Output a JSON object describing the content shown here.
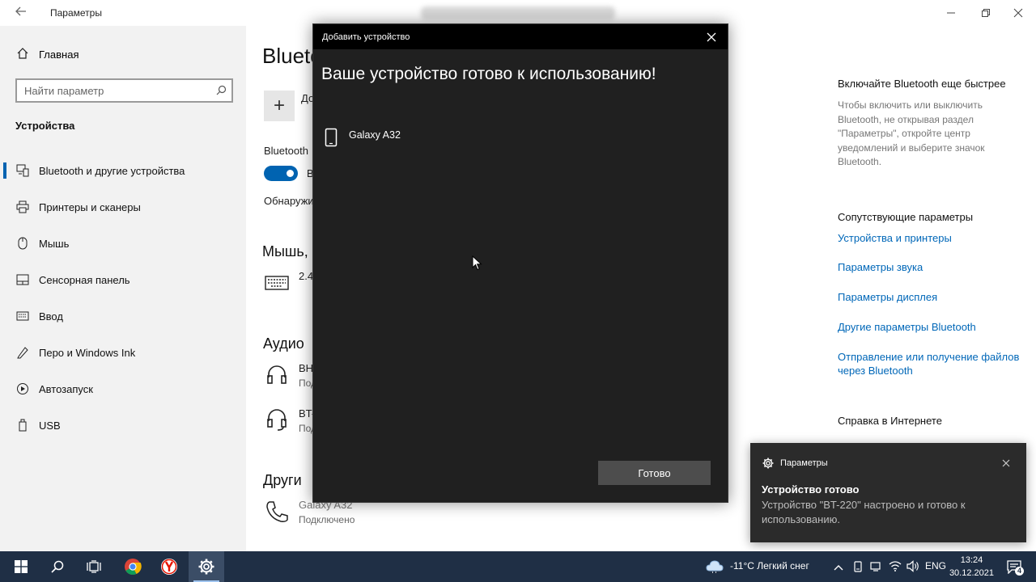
{
  "window": {
    "title": "Параметры"
  },
  "sidebar": {
    "home_label": "Главная",
    "search_placeholder": "Найти параметр",
    "section_label": "Устройства",
    "items": [
      {
        "label": "Bluetooth и другие устройства",
        "icon": "bluetooth-devices-icon",
        "active": true
      },
      {
        "label": "Принтеры и сканеры",
        "icon": "printer-icon"
      },
      {
        "label": "Мышь",
        "icon": "mouse-icon"
      },
      {
        "label": "Сенсорная панель",
        "icon": "touchpad-icon"
      },
      {
        "label": "Ввод",
        "icon": "keyboard-icon"
      },
      {
        "label": "Перо и Windows Ink",
        "icon": "pen-icon"
      },
      {
        "label": "Автозапуск",
        "icon": "autoplay-icon"
      },
      {
        "label": "USB",
        "icon": "usb-icon"
      }
    ]
  },
  "main": {
    "page_title": "Blueto",
    "add_label": "До",
    "bluetooth_label": "Bluetooth",
    "toggle_state": "on",
    "toggle_text": "В",
    "discover_text": "Обнаружи",
    "section_mouse": "Мышь,",
    "keyboard_text": "2.4",
    "section_audio": "Аудио",
    "audio1_name": "ВН",
    "audio1_status": "Под",
    "audio2_name": "BT-",
    "audio2_status": "Под",
    "section_other": "Други",
    "other_device_name": "Galaxy A32",
    "other_device_status": "Подключено"
  },
  "right_pane": {
    "faster_heading": "Включайте Bluetooth еще быстрее",
    "faster_text": "Чтобы включить или выключить Bluetooth, не открывая раздел \"Параметры\", откройте центр уведомлений и выберите значок Bluetooth.",
    "related_heading": "Сопутствующие параметры",
    "links": [
      "Устройства и принтеры",
      "Параметры звука",
      "Параметры дисплея",
      "Другие параметры Bluetooth",
      "Отправление или получение файлов через Bluetooth"
    ],
    "help_heading": "Справка в Интернете"
  },
  "dialog": {
    "title": "Добавить устройство",
    "heading": "Ваше устройство готово к использованию!",
    "device_name": "Galaxy A32",
    "done_button": "Готово"
  },
  "toast": {
    "app_name": "Параметры",
    "title": "Устройство готово",
    "body": "Устройство \"BT-220\" настроено и готово к использованию."
  },
  "taskbar": {
    "weather": "-11°C  Легкий снег",
    "language": "ENG",
    "time": "13:24",
    "date": "30.12.2021",
    "notification_count": "4"
  },
  "colors": {
    "accent": "#0063b1",
    "link": "#0067b8",
    "taskbar": "#1f2f45",
    "dialog_bg": "#202020"
  }
}
